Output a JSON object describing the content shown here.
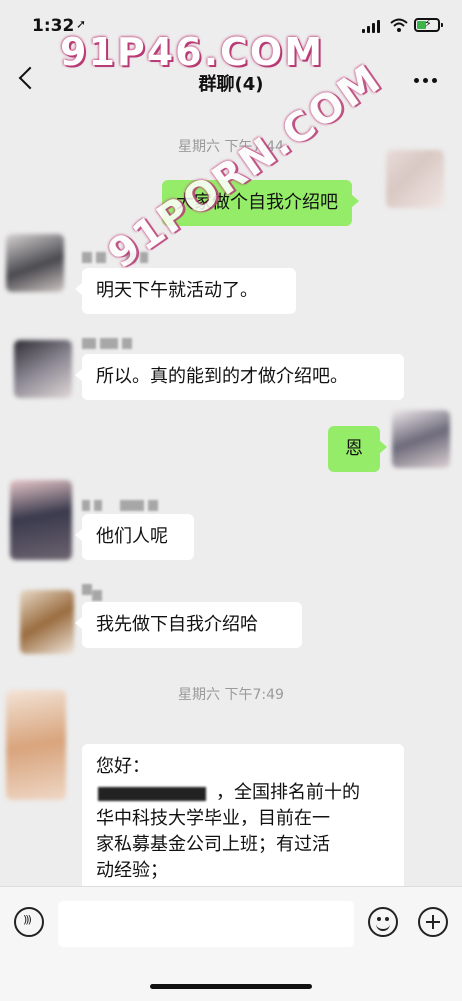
{
  "status": {
    "time": "1:32",
    "location_icon": "location-arrow-icon"
  },
  "header": {
    "title": "群聊(4)",
    "back_icon": "chevron-left-icon",
    "more_icon": "more-dots-icon"
  },
  "messages": [
    {
      "type": "timestamp",
      "text": "星期六 下午7:44"
    },
    {
      "side": "right",
      "text": "大家做个自我介绍吧"
    },
    {
      "side": "left",
      "text": "明天下午就活动了。"
    },
    {
      "side": "left",
      "text": "所以。真的能到的才做介绍吧。"
    },
    {
      "side": "right",
      "text": "恩"
    },
    {
      "side": "left",
      "text": "他们人呢"
    },
    {
      "side": "left",
      "text": "我先做下自我介绍哈"
    },
    {
      "type": "timestamp",
      "text": "星期六 下午7:49"
    },
    {
      "side": "left",
      "lines": [
        "您好：",
        "，全国排名前十的",
        "华中科技大学毕业，目前在一",
        "家私募基金公司上班；有过活",
        "动经验；"
      ]
    }
  ],
  "watermarks": [
    "91P46.COM",
    "91PORN.COM"
  ],
  "input_bar": {
    "voice_icon": "voice-icon",
    "emoji_icon": "emoji-icon",
    "plus_icon": "plus-icon"
  },
  "colors": {
    "background": "#ededed",
    "self_bubble": "#95ec69",
    "other_bubble": "#ffffff",
    "timestamp": "#9a9a9a"
  }
}
